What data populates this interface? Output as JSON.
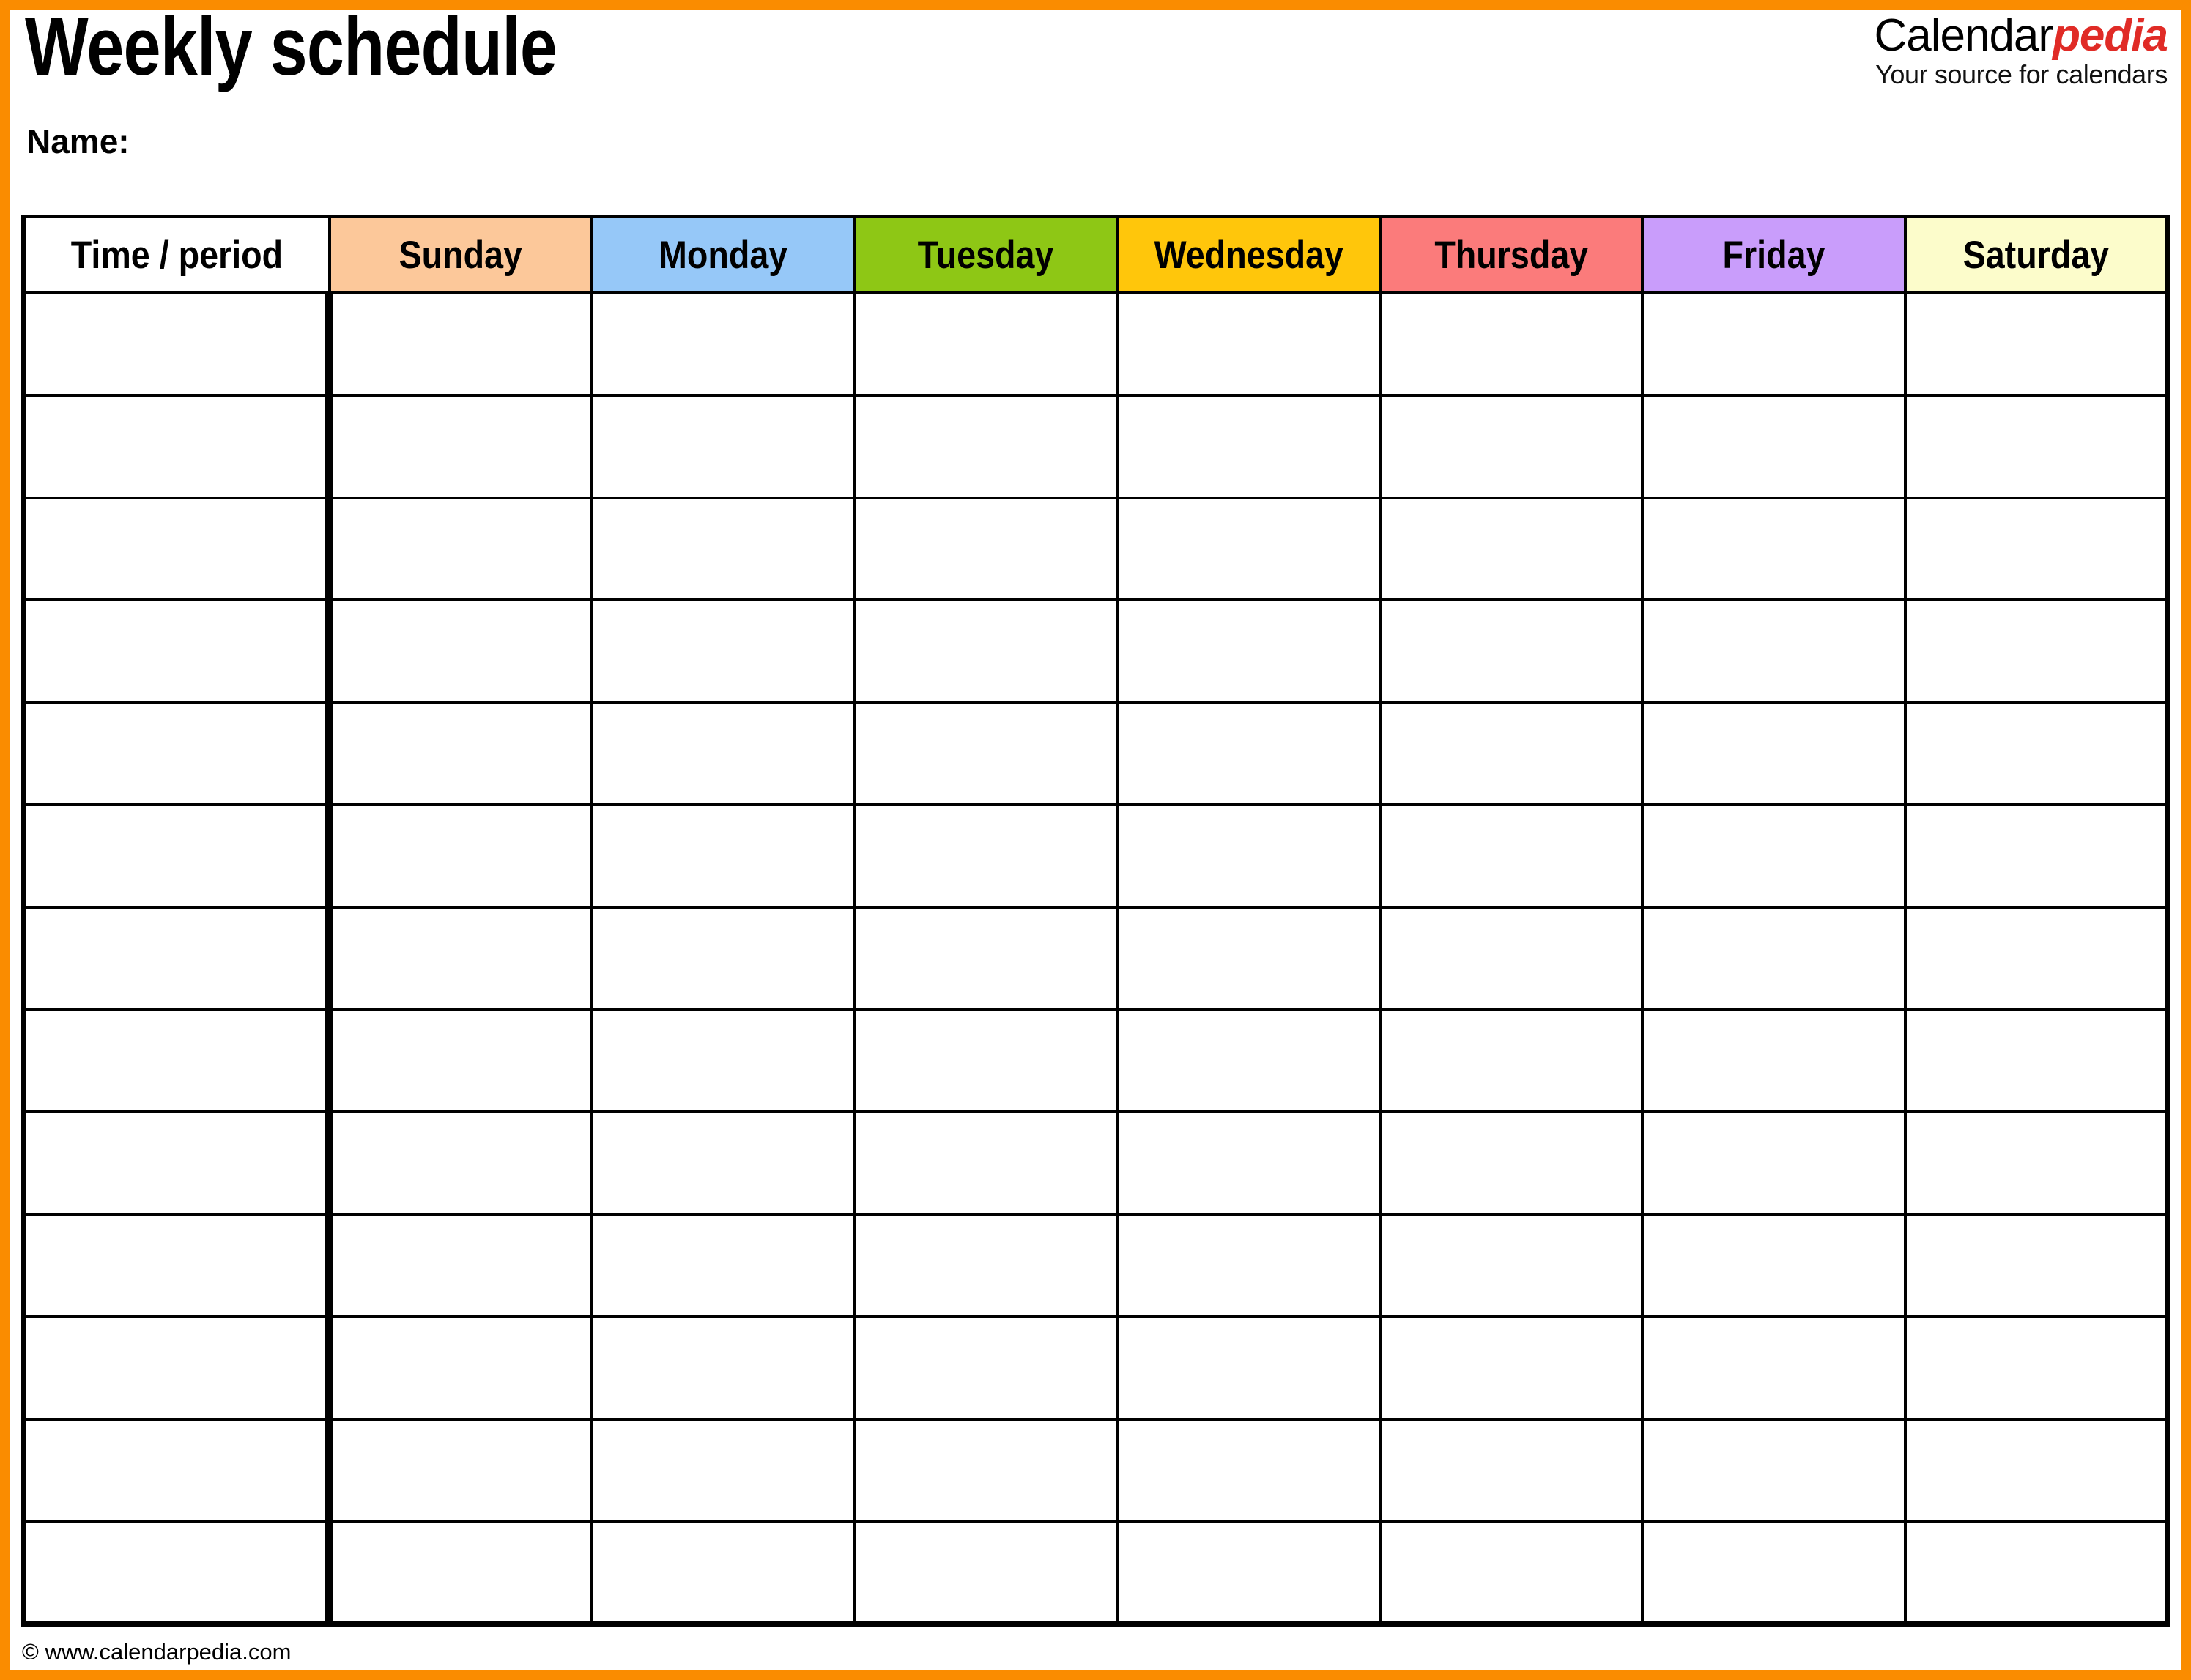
{
  "document": {
    "title": "Weekly schedule",
    "name_label": "Name:",
    "footer": "© www.calendarpedia.com"
  },
  "brand": {
    "name_primary": "Calendar",
    "name_accent": "pedia",
    "tagline": "Your source for calendars",
    "accent_color": "#e02b26",
    "border_color": "#fa8c00"
  },
  "table": {
    "time_column_header": "Time / period",
    "day_headers": [
      {
        "label": "Sunday",
        "color": "#fcc89a"
      },
      {
        "label": "Monday",
        "color": "#96c8f8"
      },
      {
        "label": "Tuesday",
        "color": "#8ec715"
      },
      {
        "label": "Wednesday",
        "color": "#ffc60b"
      },
      {
        "label": "Thursday",
        "color": "#fb7b7b"
      },
      {
        "label": "Friday",
        "color": "#c99dfb"
      },
      {
        "label": "Saturday",
        "color": "#fcfccb"
      }
    ],
    "row_count": 13,
    "rows": [
      {
        "time": "",
        "cells": [
          "",
          "",
          "",
          "",
          "",
          "",
          ""
        ]
      },
      {
        "time": "",
        "cells": [
          "",
          "",
          "",
          "",
          "",
          "",
          ""
        ]
      },
      {
        "time": "",
        "cells": [
          "",
          "",
          "",
          "",
          "",
          "",
          ""
        ]
      },
      {
        "time": "",
        "cells": [
          "",
          "",
          "",
          "",
          "",
          "",
          ""
        ]
      },
      {
        "time": "",
        "cells": [
          "",
          "",
          "",
          "",
          "",
          "",
          ""
        ]
      },
      {
        "time": "",
        "cells": [
          "",
          "",
          "",
          "",
          "",
          "",
          ""
        ]
      },
      {
        "time": "",
        "cells": [
          "",
          "",
          "",
          "",
          "",
          "",
          ""
        ]
      },
      {
        "time": "",
        "cells": [
          "",
          "",
          "",
          "",
          "",
          "",
          ""
        ]
      },
      {
        "time": "",
        "cells": [
          "",
          "",
          "",
          "",
          "",
          "",
          ""
        ]
      },
      {
        "time": "",
        "cells": [
          "",
          "",
          "",
          "",
          "",
          "",
          ""
        ]
      },
      {
        "time": "",
        "cells": [
          "",
          "",
          "",
          "",
          "",
          "",
          ""
        ]
      },
      {
        "time": "",
        "cells": [
          "",
          "",
          "",
          "",
          "",
          "",
          ""
        ]
      },
      {
        "time": "",
        "cells": [
          "",
          "",
          "",
          "",
          "",
          "",
          ""
        ]
      }
    ]
  }
}
